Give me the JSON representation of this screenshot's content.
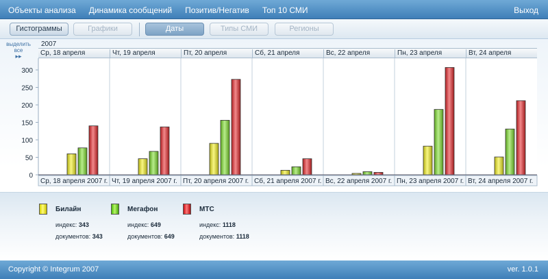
{
  "topbar": {
    "menu": [
      "Объекты анализа",
      "Динамика сообщений",
      "Позитив/Негатив",
      "Топ 10 СМИ"
    ],
    "exit": "Выход"
  },
  "toolbar": {
    "histograms": "Гистограммы",
    "graphs": "Графики",
    "dates": "Даты",
    "media_types": "Типы СМИ",
    "regions": "Регионы"
  },
  "select_all": "выделить все",
  "select_all_arrow": "▸▸",
  "year": "2007",
  "day_headers": [
    "Ср, 18 апреля",
    "Чт, 19 апреля",
    "Пт, 20 апреля",
    "Сб, 21 апреля",
    "Вс, 22 апреля",
    "Пн, 23 апреля",
    "Вт, 24 апреля"
  ],
  "chart_data": {
    "type": "bar",
    "title": "",
    "xlabel": "",
    "ylabel": "",
    "ylim": [
      0,
      300
    ],
    "yticks": [
      0,
      50,
      100,
      150,
      200,
      250,
      300
    ],
    "grid": false,
    "categories": [
      "Ср, 18 апреля 2007 г.",
      "Чт, 19 апреля 2007 г.",
      "Пт, 20 апреля 2007 г.",
      "Сб, 21 апреля 2007 г.",
      "Вс, 22 апреля 2007 г.",
      "Пн, 23 апреля 2007 г.",
      "Вт, 24 апреля 2007 г."
    ],
    "series": [
      {
        "name": "Билайн",
        "color": "#f2ee1c",
        "values": [
          60,
          46,
          90,
          13,
          4,
          82,
          51
        ]
      },
      {
        "name": "Мегафон",
        "color": "#7cdc2a",
        "values": [
          77,
          67,
          156,
          23,
          9,
          187,
          131
        ]
      },
      {
        "name": "МТС",
        "color": "#e8262a",
        "values": [
          140,
          137,
          273,
          46,
          7,
          307,
          212
        ]
      }
    ]
  },
  "legend": {
    "index_label": "индекс:",
    "docs_label": "документов:",
    "items": [
      {
        "name": "Билайн",
        "index": "343",
        "docs": "343"
      },
      {
        "name": "Мегафон",
        "index": "649",
        "docs": "649"
      },
      {
        "name": "МТС",
        "index": "1118",
        "docs": "1118"
      }
    ]
  },
  "footer": {
    "copyright": "Copyright © Integrum 2007",
    "version": "ver. 1.0.1"
  }
}
